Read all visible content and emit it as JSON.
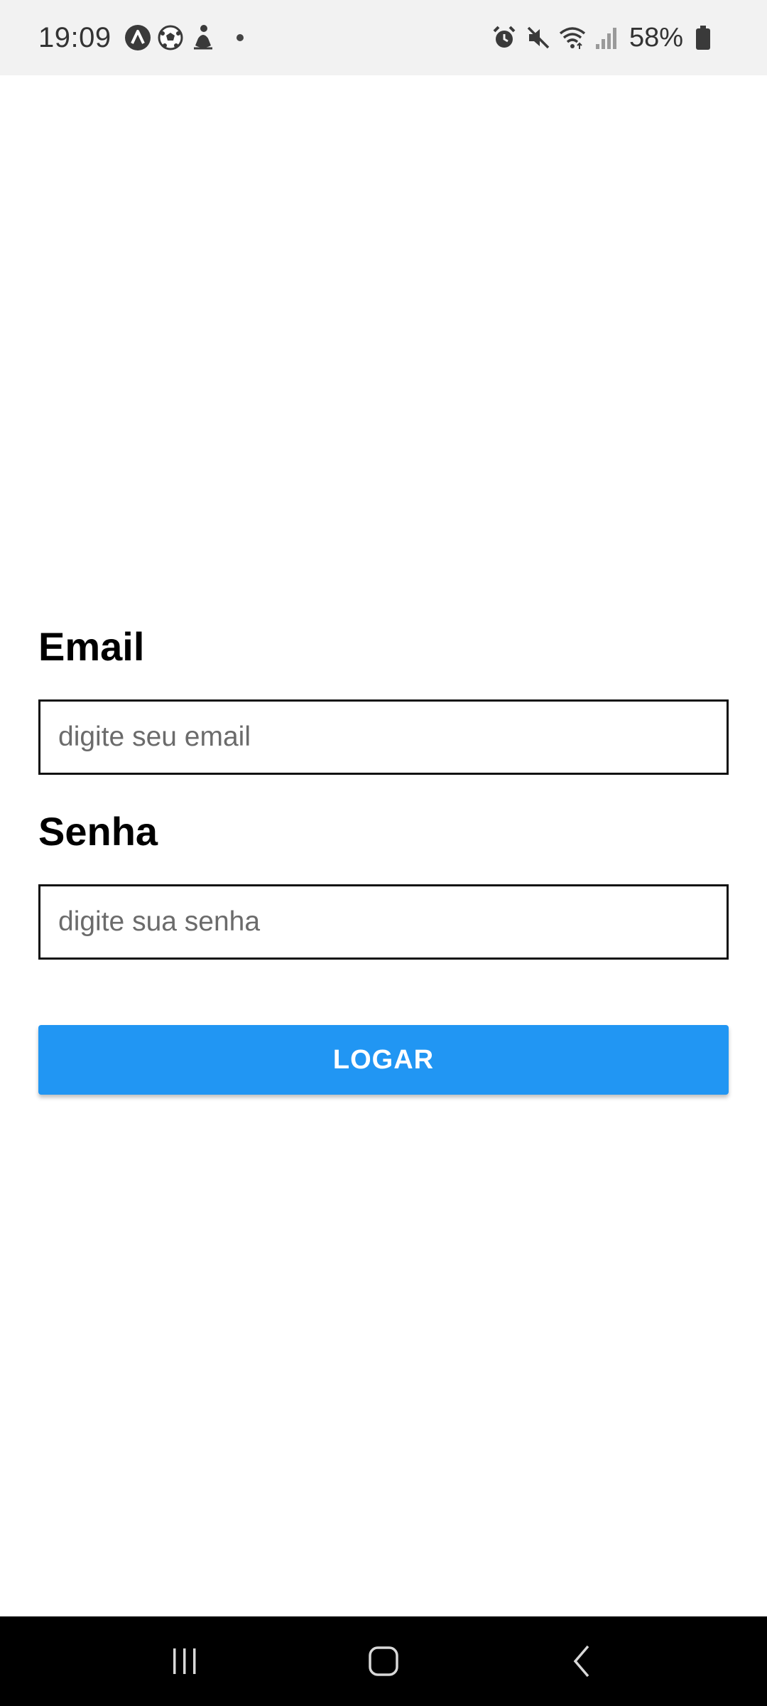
{
  "status_bar": {
    "time": "19:09",
    "left_icons": [
      "app-icon",
      "soccer-ball-icon",
      "yoga-icon",
      "notification-dot-icon"
    ],
    "right_icons": [
      "alarm-icon",
      "mute-icon",
      "wifi-icon",
      "signal-icon",
      "battery-icon"
    ],
    "battery": "58%"
  },
  "form": {
    "email_label": "Email",
    "email_placeholder": "digite seu email",
    "email_value": "",
    "password_label": "Senha",
    "password_placeholder": "digite sua senha",
    "password_value": "",
    "login_button_label": "LOGAR"
  },
  "nav_bar": {
    "buttons": [
      "recent-apps-icon",
      "home-icon",
      "back-icon"
    ]
  },
  "colors": {
    "accent": "#2196f3",
    "status_bar_bg": "#f2f2f2",
    "nav_bar_bg": "#000000",
    "input_border": "#111111"
  }
}
